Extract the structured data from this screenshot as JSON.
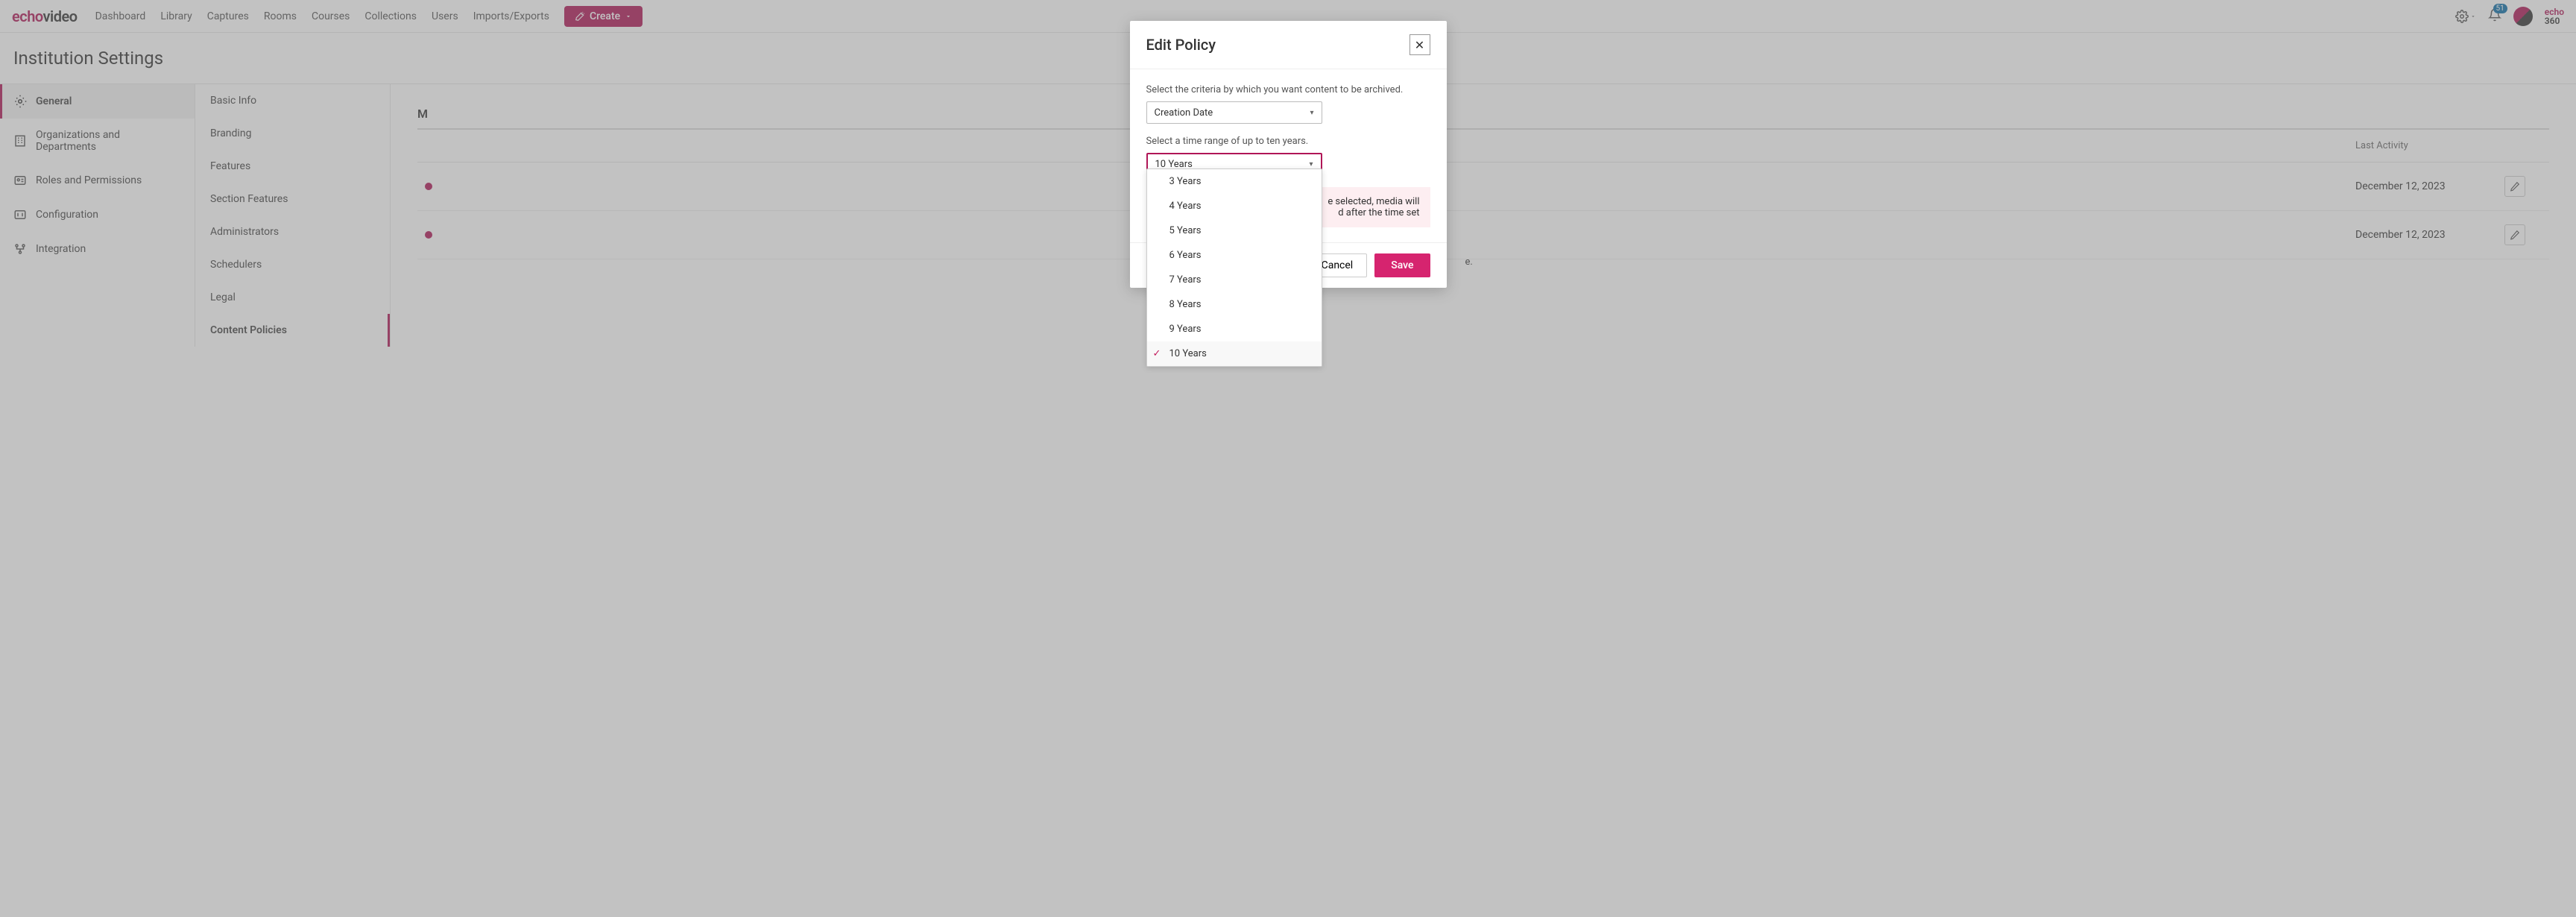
{
  "nav": {
    "logo_e": "echo",
    "logo_rest": "video",
    "links": [
      "Dashboard",
      "Library",
      "Captures",
      "Rooms",
      "Courses",
      "Collections",
      "Users",
      "Imports/Exports"
    ],
    "create": "Create",
    "badge": "51",
    "brand_top": "echo",
    "brand_bot": "360"
  },
  "page_title": "Institution Settings",
  "sidebar1": [
    {
      "label": "General",
      "active": true
    },
    {
      "label": "Organizations and Departments"
    },
    {
      "label": "Roles and Permissions"
    },
    {
      "label": "Configuration"
    },
    {
      "label": "Integration"
    }
  ],
  "sidebar2": [
    {
      "label": "Basic Info"
    },
    {
      "label": "Branding"
    },
    {
      "label": "Features"
    },
    {
      "label": "Section Features"
    },
    {
      "label": "Administrators"
    },
    {
      "label": "Schedulers"
    },
    {
      "label": "Legal"
    },
    {
      "label": "Content Policies",
      "active": true
    }
  ],
  "main": {
    "section_title": "M",
    "headers": {
      "activity": "Last Activity"
    },
    "rows": [
      {
        "activity": "December 12, 2023"
      },
      {
        "activity": "December 12, 2023"
      }
    ]
  },
  "modal": {
    "title": "Edit Policy",
    "label_criteria": "Select the criteria by which you want content to be archived.",
    "criteria_value": "Creation Date",
    "label_range": "Select a time range of up to ten years.",
    "range_value": "10 Years",
    "warning_fragment_1": "e selected, media will",
    "warning_fragment_2": "d after the time set",
    "cancel": "Cancel",
    "save": "Save",
    "options": [
      "3 Years",
      "4 Years",
      "5 Years",
      "6 Years",
      "7 Years",
      "8 Years",
      "9 Years",
      "10 Years"
    ],
    "selected_option": "10 Years",
    "footnote_fragment": "e."
  }
}
